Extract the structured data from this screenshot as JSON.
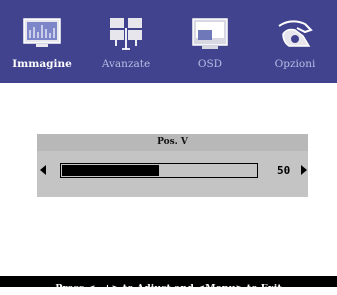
{
  "tabs": [
    {
      "label": "Immagine",
      "icon": "picture-icon",
      "active": true
    },
    {
      "label": "Avanzate",
      "icon": "network-icon",
      "active": false
    },
    {
      "label": "OSD",
      "icon": "osd-window-icon",
      "active": false
    },
    {
      "label": "Opzioni",
      "icon": "hand-options-icon",
      "active": false
    }
  ],
  "panel": {
    "title": "Pos. V",
    "value": "50",
    "level_percent": 50
  },
  "footer": {
    "hint": "Press <–,+> to Adjust and <Menu> to Exit"
  },
  "colors": {
    "menu_bar": "#41438f",
    "panel": "#c4c4c4",
    "footer": "#000000"
  }
}
